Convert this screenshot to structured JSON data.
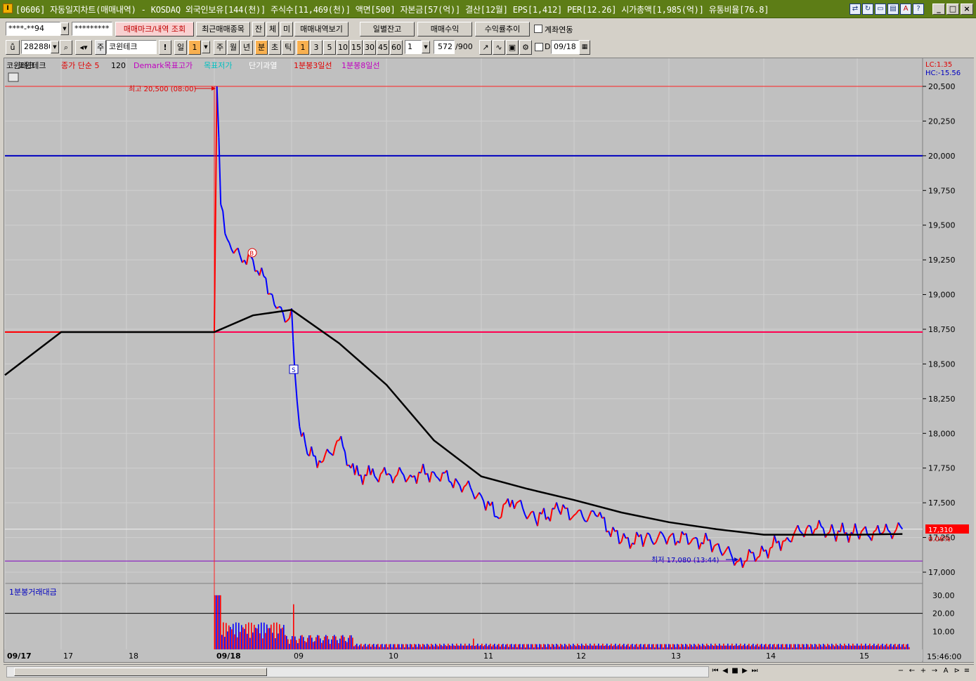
{
  "window": {
    "title": "[0606] 자동일지차트(매매내역) - KOSDAQ 외국인보유[144(천)] 주식수[11,469(천)] 액면[500] 자본금[57(억)] 결산[12월] EPS[1,412] PER[12.26] 시가총액[1,985(억)] 유통비율[76.8]",
    "app_icon": "I"
  },
  "toolbar1": {
    "account": "****-**94",
    "password": "*********",
    "buttons": [
      "매매마크/내역 조회",
      "최근매매종목",
      "잔",
      "체",
      "미",
      "매매내역보기"
    ],
    "right_buttons": [
      "일별잔고",
      "매매수익",
      "수익률추이"
    ],
    "checkbox_label": "계좌연동"
  },
  "toolbar2": {
    "code": "282880",
    "stock_badge": "주",
    "stock_name": "코윈테크",
    "period_buttons": [
      "일",
      "1"
    ],
    "intervals": [
      "주",
      "월",
      "년",
      "분",
      "초",
      "틱"
    ],
    "minute_buttons": [
      "1",
      "3",
      "5",
      "10",
      "15",
      "30",
      "45",
      "60"
    ],
    "count_value": "1",
    "bars_value": "572",
    "bars_total": "/900",
    "d_label": "D",
    "date_value": "09/18"
  },
  "legend": {
    "stock": "코윈테크",
    "ma": "종가 단순 5",
    "ma_period": "120",
    "demark": "Demark목표고가",
    "demark2": "목표저가",
    "short": "단기과열",
    "line3": "1분봉3일선",
    "line8": "1분봉8일선"
  },
  "lc_hc": {
    "lc": "LC:1.35",
    "hc": "HC:-15.56"
  },
  "annotations": {
    "high": "최고 20,500 (08:00)",
    "low": "최저 17,080 (13:44)",
    "buy": "B",
    "sell": "S"
  },
  "current_price": "17,310",
  "current_pct": "0.06%",
  "volume_label": "1분봉거래대금",
  "time_display": "15:46:00",
  "colors": {
    "up": "#ff0000",
    "down": "#0000ff",
    "ma": "#000000",
    "line_20000": "#0000c0",
    "line_18730": "#ff0050",
    "line_17080": "#8000c0",
    "price_tag": "#ff0000"
  },
  "chart_data": {
    "type": "line",
    "title": "",
    "ylim": [
      16900,
      20600
    ],
    "y_ticks": [
      "20,500",
      "20,250",
      "20,000",
      "19,750",
      "19,500",
      "19,250",
      "19,000",
      "18,750",
      "18,500",
      "18,250",
      "18,000",
      "17,750",
      "17,500",
      "17,250",
      "17,000"
    ],
    "y_tick_values": [
      20500,
      20250,
      20000,
      19750,
      19500,
      19250,
      19000,
      18750,
      18500,
      18250,
      18000,
      17750,
      17500,
      17250,
      17000
    ],
    "x_ticks": [
      "09/17",
      "17",
      "18",
      "09/18",
      "09",
      "10",
      "11",
      "12",
      "13",
      "14",
      "15"
    ],
    "horizontal_lines": [
      20500,
      20000,
      18730,
      17310,
      17080
    ],
    "price_series": {
      "name": "코윈테크",
      "x": [
        "09/17 16:00",
        "09/17 18:00",
        "09/18 08:00",
        "09/18 08:02",
        "09/18 08:05",
        "09/18 08:10",
        "09/18 08:20",
        "09/18 08:30",
        "09/18 08:45",
        "09/18 08:55",
        "09/18 09:00",
        "09/18 09:02",
        "09/18 09:05",
        "09/18 09:10",
        "09/18 09:20",
        "09/18 09:30",
        "09/18 09:40",
        "09/18 09:50",
        "09/18 10:00",
        "09/18 10:15",
        "09/18 10:30",
        "09/18 10:45",
        "09/18 11:00",
        "09/18 11:10",
        "09/18 11:20",
        "09/18 11:35",
        "09/18 11:50",
        "09/18 12:00",
        "09/18 12:15",
        "09/18 12:30",
        "09/18 12:45",
        "09/18 13:00",
        "09/18 13:15",
        "09/18 13:30",
        "09/18 13:44",
        "09/18 14:00",
        "09/18 14:15",
        "09/18 14:30",
        "09/18 14:45",
        "09/18 15:00",
        "09/18 15:15",
        "09/18 15:30"
      ],
      "values": [
        18730,
        18730,
        18730,
        20500,
        19650,
        19400,
        19280,
        19250,
        19000,
        18800,
        18900,
        18450,
        18050,
        17850,
        17800,
        17950,
        17700,
        17700,
        17700,
        17700,
        17720,
        17650,
        17550,
        17400,
        17520,
        17380,
        17450,
        17410,
        17400,
        17220,
        17240,
        17250,
        17240,
        17200,
        17080,
        17150,
        17250,
        17330,
        17290,
        17280,
        17280,
        17310
      ]
    },
    "ma_series": {
      "x": [
        "09/17 16:00",
        "09/17 17:00",
        "09/18 08:00",
        "09/18 08:30",
        "09/18 09:00",
        "09/18 09:30",
        "09/18 10:00",
        "09/18 10:30",
        "09/18 11:00",
        "09/18 11:30",
        "09/18 12:00",
        "09/18 12:30",
        "09/18 13:00",
        "09/18 13:30",
        "09/18 14:00",
        "09/18 14:30",
        "09/18 15:00",
        "09/18 15:30"
      ],
      "values": [
        18420,
        18730,
        18730,
        18850,
        18890,
        18650,
        18350,
        17950,
        17690,
        17600,
        17520,
        17430,
        17360,
        17310,
        17270,
        17270,
        17270,
        17275
      ]
    },
    "volume": {
      "label": "1분봉거래대금",
      "ylim": [
        0,
        35
      ],
      "y_ticks": [
        "30.00",
        "20.00",
        "10.00"
      ],
      "y_tick_values": [
        30,
        20,
        10
      ],
      "reference_line": 20
    }
  }
}
